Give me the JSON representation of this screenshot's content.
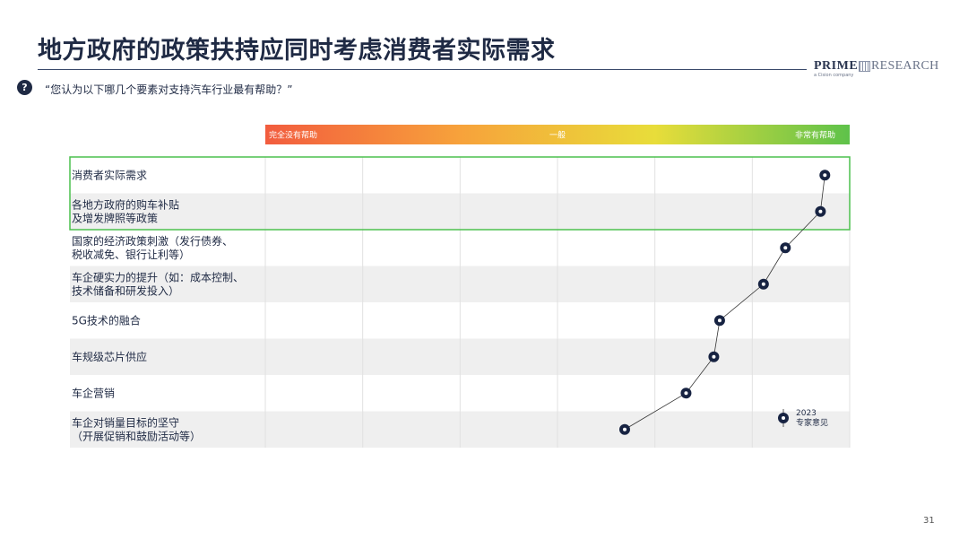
{
  "title": "地方政府的政策扶持应同时考虑消费者实际需求",
  "logo": {
    "prime": "PRIME",
    "research": "RESEARCH",
    "sub": "a Cision company"
  },
  "question": {
    "icon": "question-mark-icon",
    "mark": "?",
    "text": "“您认为以下哪几个要素对支持汽车行业最有帮助？”"
  },
  "page_number": "31",
  "colors": {
    "title": "#1f2a44",
    "highlight_border": "#4cc04e",
    "point_fill": "#172342",
    "band_gray": "#efefef",
    "gradient": [
      "#f25c3e",
      "#f7a23b",
      "#e8dd3a",
      "#5ec24a"
    ]
  },
  "chart_data": {
    "type": "line",
    "orientation": "horizontal",
    "scale": {
      "labels": [
        "完全没有帮助",
        "一般",
        "非常有帮助"
      ],
      "xlim": [
        1,
        5
      ]
    },
    "categories": [
      "消费者实际需求",
      "各地方政府的购车补贴\n及增发牌照等政策",
      "国家的经济政策刺激（发行债券、\n税收减免、银行让利等）",
      "车企硬实力的提升（如：成本控制、\n技术储备和研发投入）",
      "5G技术的融合",
      "车规级芯片供应",
      "车企营销",
      "车企对销量目标的坚守\n（开展促销和鼓励活动等）"
    ],
    "series": [
      {
        "name": "2023\n专家意见",
        "values": [
          4.83,
          4.8,
          4.56,
          4.41,
          4.11,
          4.07,
          3.88,
          3.46
        ]
      }
    ],
    "highlighted_categories": [
      0,
      1
    ],
    "legend": "bottom-right",
    "grid": true
  }
}
